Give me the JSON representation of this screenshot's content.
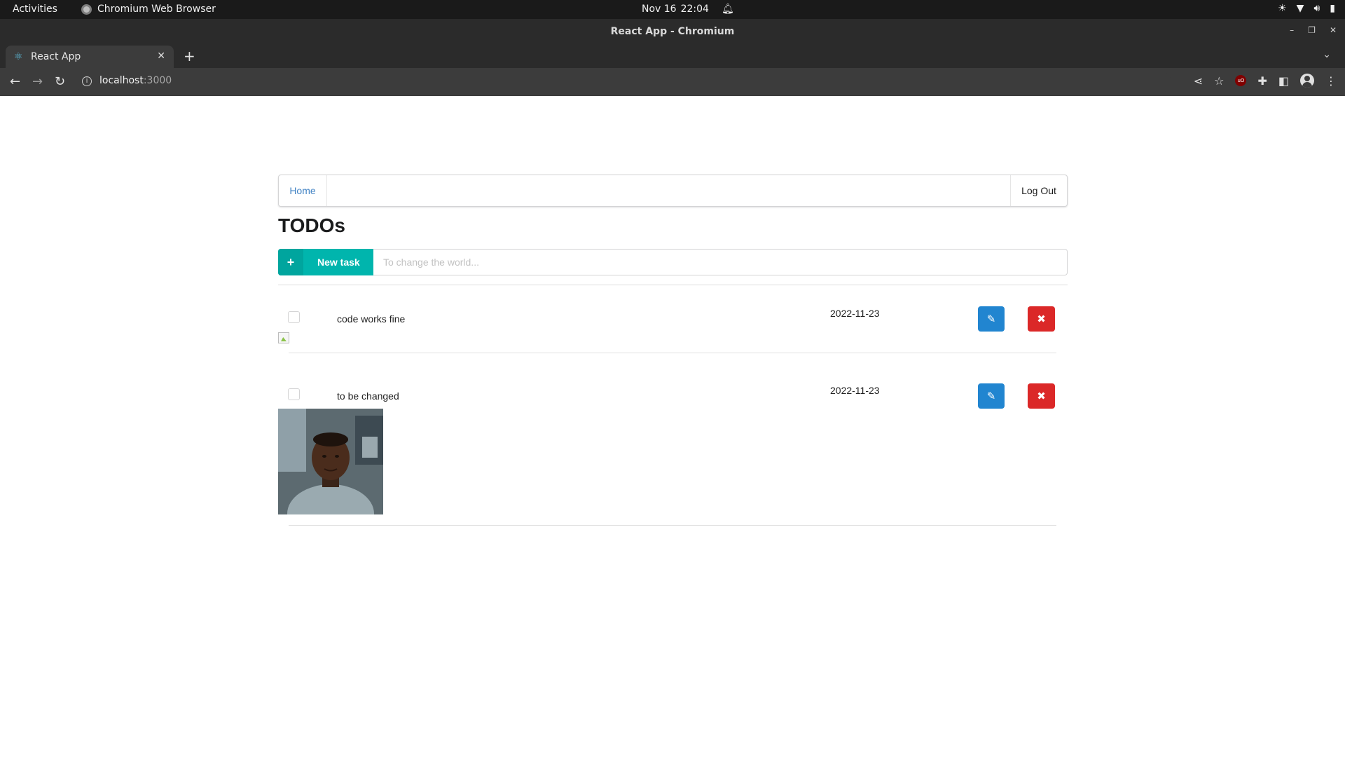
{
  "os": {
    "activities": "Activities",
    "app_name": "Chromium Web Browser",
    "date": "Nov 16",
    "time": "22:04"
  },
  "window": {
    "title": "React App - Chromium"
  },
  "tabs": [
    {
      "label": "React App",
      "icon": "react-icon"
    }
  ],
  "address": {
    "host": "localhost",
    "port": ":3000"
  },
  "nav": {
    "home": "Home",
    "logout": "Log Out"
  },
  "page": {
    "title": "TODOs",
    "new_task_label": "New task",
    "new_task_placeholder": "To change the world...",
    "new_task_value": ""
  },
  "todos": [
    {
      "text": "code works fine",
      "date": "2022-11-23",
      "done": false,
      "image": "broken"
    },
    {
      "text": "to be changed",
      "date": "2022-11-23",
      "done": false,
      "image": "photo"
    }
  ],
  "colors": {
    "teal": "#00b5ad",
    "blue": "#2185d0",
    "red": "#db2828",
    "link": "#4183c4"
  }
}
